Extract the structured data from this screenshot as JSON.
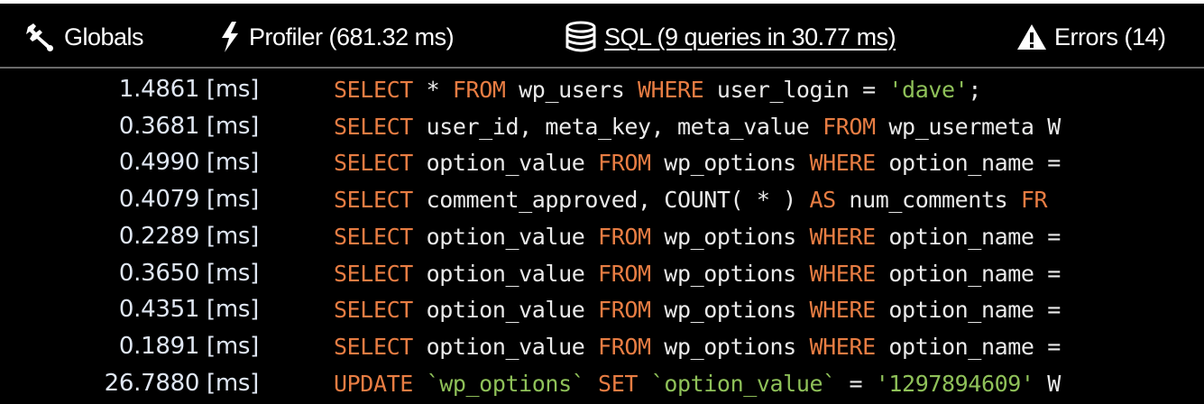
{
  "tabs": [
    {
      "label": "Globals",
      "icon": "wrench-icon"
    },
    {
      "label": "Profiler (681.32 ms)",
      "icon": "lightning-icon"
    },
    {
      "label": "SQL (9 queries in 30.77 ms)",
      "icon": "database-icon",
      "active": true
    },
    {
      "label": "Errors (14)",
      "icon": "warning-icon"
    }
  ],
  "colors": {
    "background": "#000000",
    "keyword": "#e87d43",
    "string": "#8fc159",
    "text": "#eaeaea",
    "time": "#dfe6f2",
    "separator": "#6a6a6a"
  },
  "queries": [
    {
      "time": "1.4861 [ms]",
      "tokens": [
        {
          "t": "SELECT",
          "k": "kw"
        },
        {
          "t": " * ",
          "k": "plain"
        },
        {
          "t": "FROM",
          "k": "kw"
        },
        {
          "t": " wp_users ",
          "k": "plain"
        },
        {
          "t": "WHERE",
          "k": "kw"
        },
        {
          "t": " user_login = ",
          "k": "plain"
        },
        {
          "t": "'dave'",
          "k": "str"
        },
        {
          "t": ";",
          "k": "plain"
        }
      ]
    },
    {
      "time": "0.3681 [ms]",
      "tokens": [
        {
          "t": "SELECT",
          "k": "kw"
        },
        {
          "t": " user_id, meta_key, meta_value ",
          "k": "plain"
        },
        {
          "t": "FROM",
          "k": "kw"
        },
        {
          "t": " wp_usermeta W",
          "k": "plain"
        }
      ]
    },
    {
      "time": "0.4990 [ms]",
      "tokens": [
        {
          "t": "SELECT",
          "k": "kw"
        },
        {
          "t": " option_value ",
          "k": "plain"
        },
        {
          "t": "FROM",
          "k": "kw"
        },
        {
          "t": " wp_options ",
          "k": "plain"
        },
        {
          "t": "WHERE",
          "k": "kw"
        },
        {
          "t": " option_name =",
          "k": "plain"
        }
      ]
    },
    {
      "time": "0.4079 [ms]",
      "tokens": [
        {
          "t": "SELECT",
          "k": "kw"
        },
        {
          "t": " comment_approved, COUNT( * ) ",
          "k": "plain"
        },
        {
          "t": "AS",
          "k": "kw"
        },
        {
          "t": " num_comments ",
          "k": "plain"
        },
        {
          "t": "FR",
          "k": "kw"
        }
      ]
    },
    {
      "time": "0.2289 [ms]",
      "tokens": [
        {
          "t": "SELECT",
          "k": "kw"
        },
        {
          "t": " option_value ",
          "k": "plain"
        },
        {
          "t": "FROM",
          "k": "kw"
        },
        {
          "t": " wp_options ",
          "k": "plain"
        },
        {
          "t": "WHERE",
          "k": "kw"
        },
        {
          "t": " option_name =",
          "k": "plain"
        }
      ]
    },
    {
      "time": "0.3650 [ms]",
      "tokens": [
        {
          "t": "SELECT",
          "k": "kw"
        },
        {
          "t": " option_value ",
          "k": "plain"
        },
        {
          "t": "FROM",
          "k": "kw"
        },
        {
          "t": " wp_options ",
          "k": "plain"
        },
        {
          "t": "WHERE",
          "k": "kw"
        },
        {
          "t": " option_name =",
          "k": "plain"
        }
      ]
    },
    {
      "time": "0.4351 [ms]",
      "tokens": [
        {
          "t": "SELECT",
          "k": "kw"
        },
        {
          "t": " option_value ",
          "k": "plain"
        },
        {
          "t": "FROM",
          "k": "kw"
        },
        {
          "t": " wp_options ",
          "k": "plain"
        },
        {
          "t": "WHERE",
          "k": "kw"
        },
        {
          "t": " option_name =",
          "k": "plain"
        }
      ]
    },
    {
      "time": "0.1891 [ms]",
      "tokens": [
        {
          "t": "SELECT",
          "k": "kw"
        },
        {
          "t": " option_value ",
          "k": "plain"
        },
        {
          "t": "FROM",
          "k": "kw"
        },
        {
          "t": " wp_options ",
          "k": "plain"
        },
        {
          "t": "WHERE",
          "k": "kw"
        },
        {
          "t": " option_name =",
          "k": "plain"
        }
      ]
    },
    {
      "time": "26.7880 [ms]",
      "tokens": [
        {
          "t": "UPDATE",
          "k": "kw"
        },
        {
          "t": " `wp_options` ",
          "k": "str"
        },
        {
          "t": "SET",
          "k": "kw"
        },
        {
          "t": " `option_value` ",
          "k": "str"
        },
        {
          "t": "= ",
          "k": "plain"
        },
        {
          "t": "'1297894609'",
          "k": "str"
        },
        {
          "t": " W",
          "k": "plain"
        }
      ]
    }
  ]
}
